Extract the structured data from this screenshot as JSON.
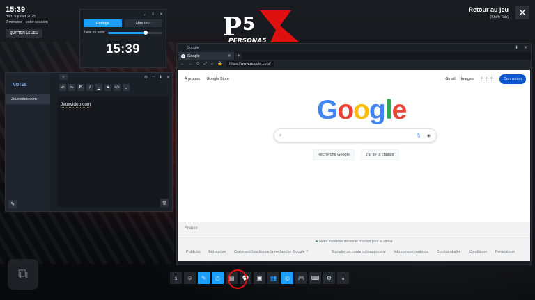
{
  "overlay": {
    "time": "15:39",
    "date": "mer. 9 juillet 2025",
    "session": "2 minutes - cette session",
    "quit_label": "QUITTER LE JEU"
  },
  "return": {
    "label": "Retour au jeu",
    "shortcut": "(Shift+Tab)"
  },
  "logo": {
    "text": "PERSONA5",
    "letter_p": "P",
    "num": "5"
  },
  "clock_widget": {
    "tabs": [
      "Horloge",
      "Minuteur"
    ],
    "text_size_label": "Taille du texte",
    "text_size_value": 0.7,
    "time": "15:39"
  },
  "notes": {
    "title": "NOTES",
    "items": [
      "Jeuxvideo.com"
    ],
    "content": "Jeuxvideo.com",
    "toolbar": [
      "↶",
      "↷",
      "B",
      "I",
      "U",
      "S",
      "</>",
      "⌄"
    ]
  },
  "browser": {
    "title": "Google",
    "tab_label": "Google",
    "url": "https://www.google.com/",
    "page": {
      "top_left": [
        "À propos",
        "Google Store"
      ],
      "top_right": [
        "Gmail",
        "Images"
      ],
      "signin": "Connexion",
      "logo": "Google",
      "buttons": [
        "Recherche Google",
        "J'ai de la chance"
      ],
      "country": "France",
      "eco": "Notre troisième décennie d'action pour le climat",
      "footer_left": [
        "Publicité",
        "Entreprise",
        "Comment fonctionne la recherche Google ?"
      ],
      "footer_right": [
        "Signaler un contenu inapproprié",
        "Info consommateurs",
        "Confidentialité",
        "Conditions",
        "Paramètres"
      ]
    }
  },
  "taskbar": {
    "icons": [
      "info-icon",
      "friends-icon",
      "notes-icon",
      "clock-icon",
      "browser-doc-icon",
      "chat-icon",
      "screenshots-icon",
      "people-icon",
      "store-icon",
      "controller-icon",
      "keyboard-icon",
      "settings-icon",
      "download-icon"
    ],
    "active": [
      2,
      3,
      8
    ]
  },
  "colors": {
    "accent": "#1a9fff",
    "annotation": "#e01010"
  }
}
